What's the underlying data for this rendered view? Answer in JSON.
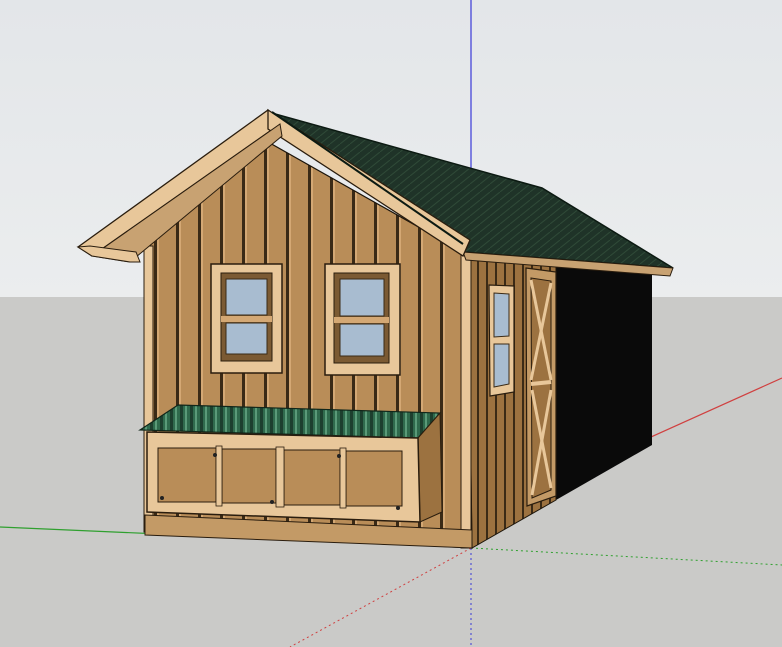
{
  "viewport": {
    "sky_top": "#e3e6e9",
    "sky_bottom": "#ebedee",
    "ground": "#cacac8"
  },
  "axes": {
    "blue": "#3a3ad8",
    "red": "#d04040",
    "green": "#2fa02f"
  },
  "model": {
    "subject": "shed-with-nesting-box",
    "wood": "#b98d58",
    "wood_dark": "#9c7240",
    "trim": "#e8c79a",
    "roof": "#1f3328",
    "roof_tin": "#2f6a4c",
    "glass": "#a8bcd0",
    "shadow": "#0a0a0a"
  }
}
